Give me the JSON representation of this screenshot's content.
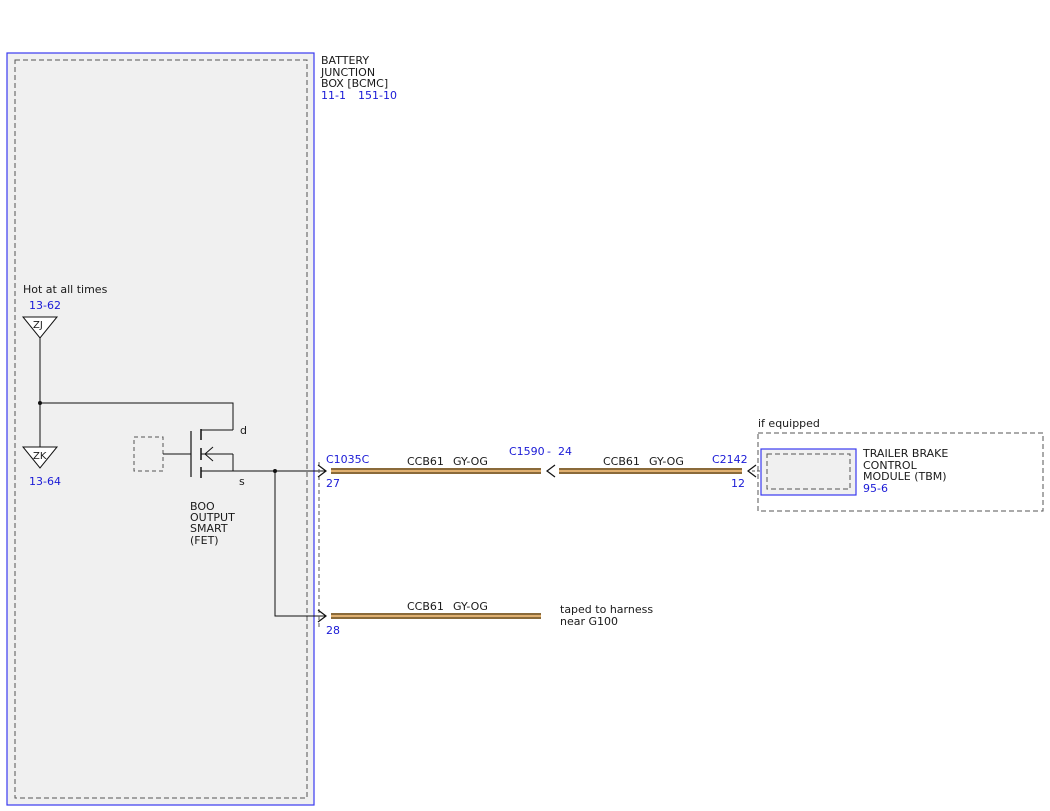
{
  "colors": {
    "module_border": "#3a3af0",
    "module_fill": "#f0f0f0",
    "dashed": "#555555",
    "wire": "#111111",
    "harness_outer": "#8a6a3a",
    "harness_inner": "#e0b070",
    "link_blue": "#1a1ad6"
  },
  "bjb": {
    "title_lines": [
      "BATTERY",
      "JUNCTION",
      "BOX [BCMC]"
    ],
    "ref_a": "11-1",
    "ref_b": "151-10"
  },
  "power_feed": {
    "label": "Hot at all times",
    "ref_top": "13-62",
    "fuse_top": "ZJ",
    "fuse_bottom": "ZK",
    "ref_bottom": "13-64"
  },
  "fet": {
    "drain_label": "d",
    "source_label": "s",
    "name_lines": [
      "BOO",
      "OUTPUT",
      "SMART",
      "(FET)"
    ]
  },
  "connectors": {
    "c1035c": "C1035C",
    "pin27": "27",
    "pin28": "28",
    "c1590": "C1590",
    "c1590_sep": "-",
    "c1590_pin": "24",
    "c2142": "C2142",
    "pin12": "12"
  },
  "wires": {
    "seg1_circuit": "CCB61",
    "seg1_color": "GY-OG",
    "seg2_circuit": "CCB61",
    "seg2_color": "GY-OG",
    "seg3_circuit": "CCB61",
    "seg3_color": "GY-OG",
    "taped_lines": [
      "taped to harness",
      "near G100"
    ]
  },
  "tbm": {
    "if_equipped": "if equipped",
    "name_lines": [
      "TRAILER BRAKE",
      "CONTROL",
      "MODULE (TBM)"
    ],
    "ref": "95-6"
  }
}
